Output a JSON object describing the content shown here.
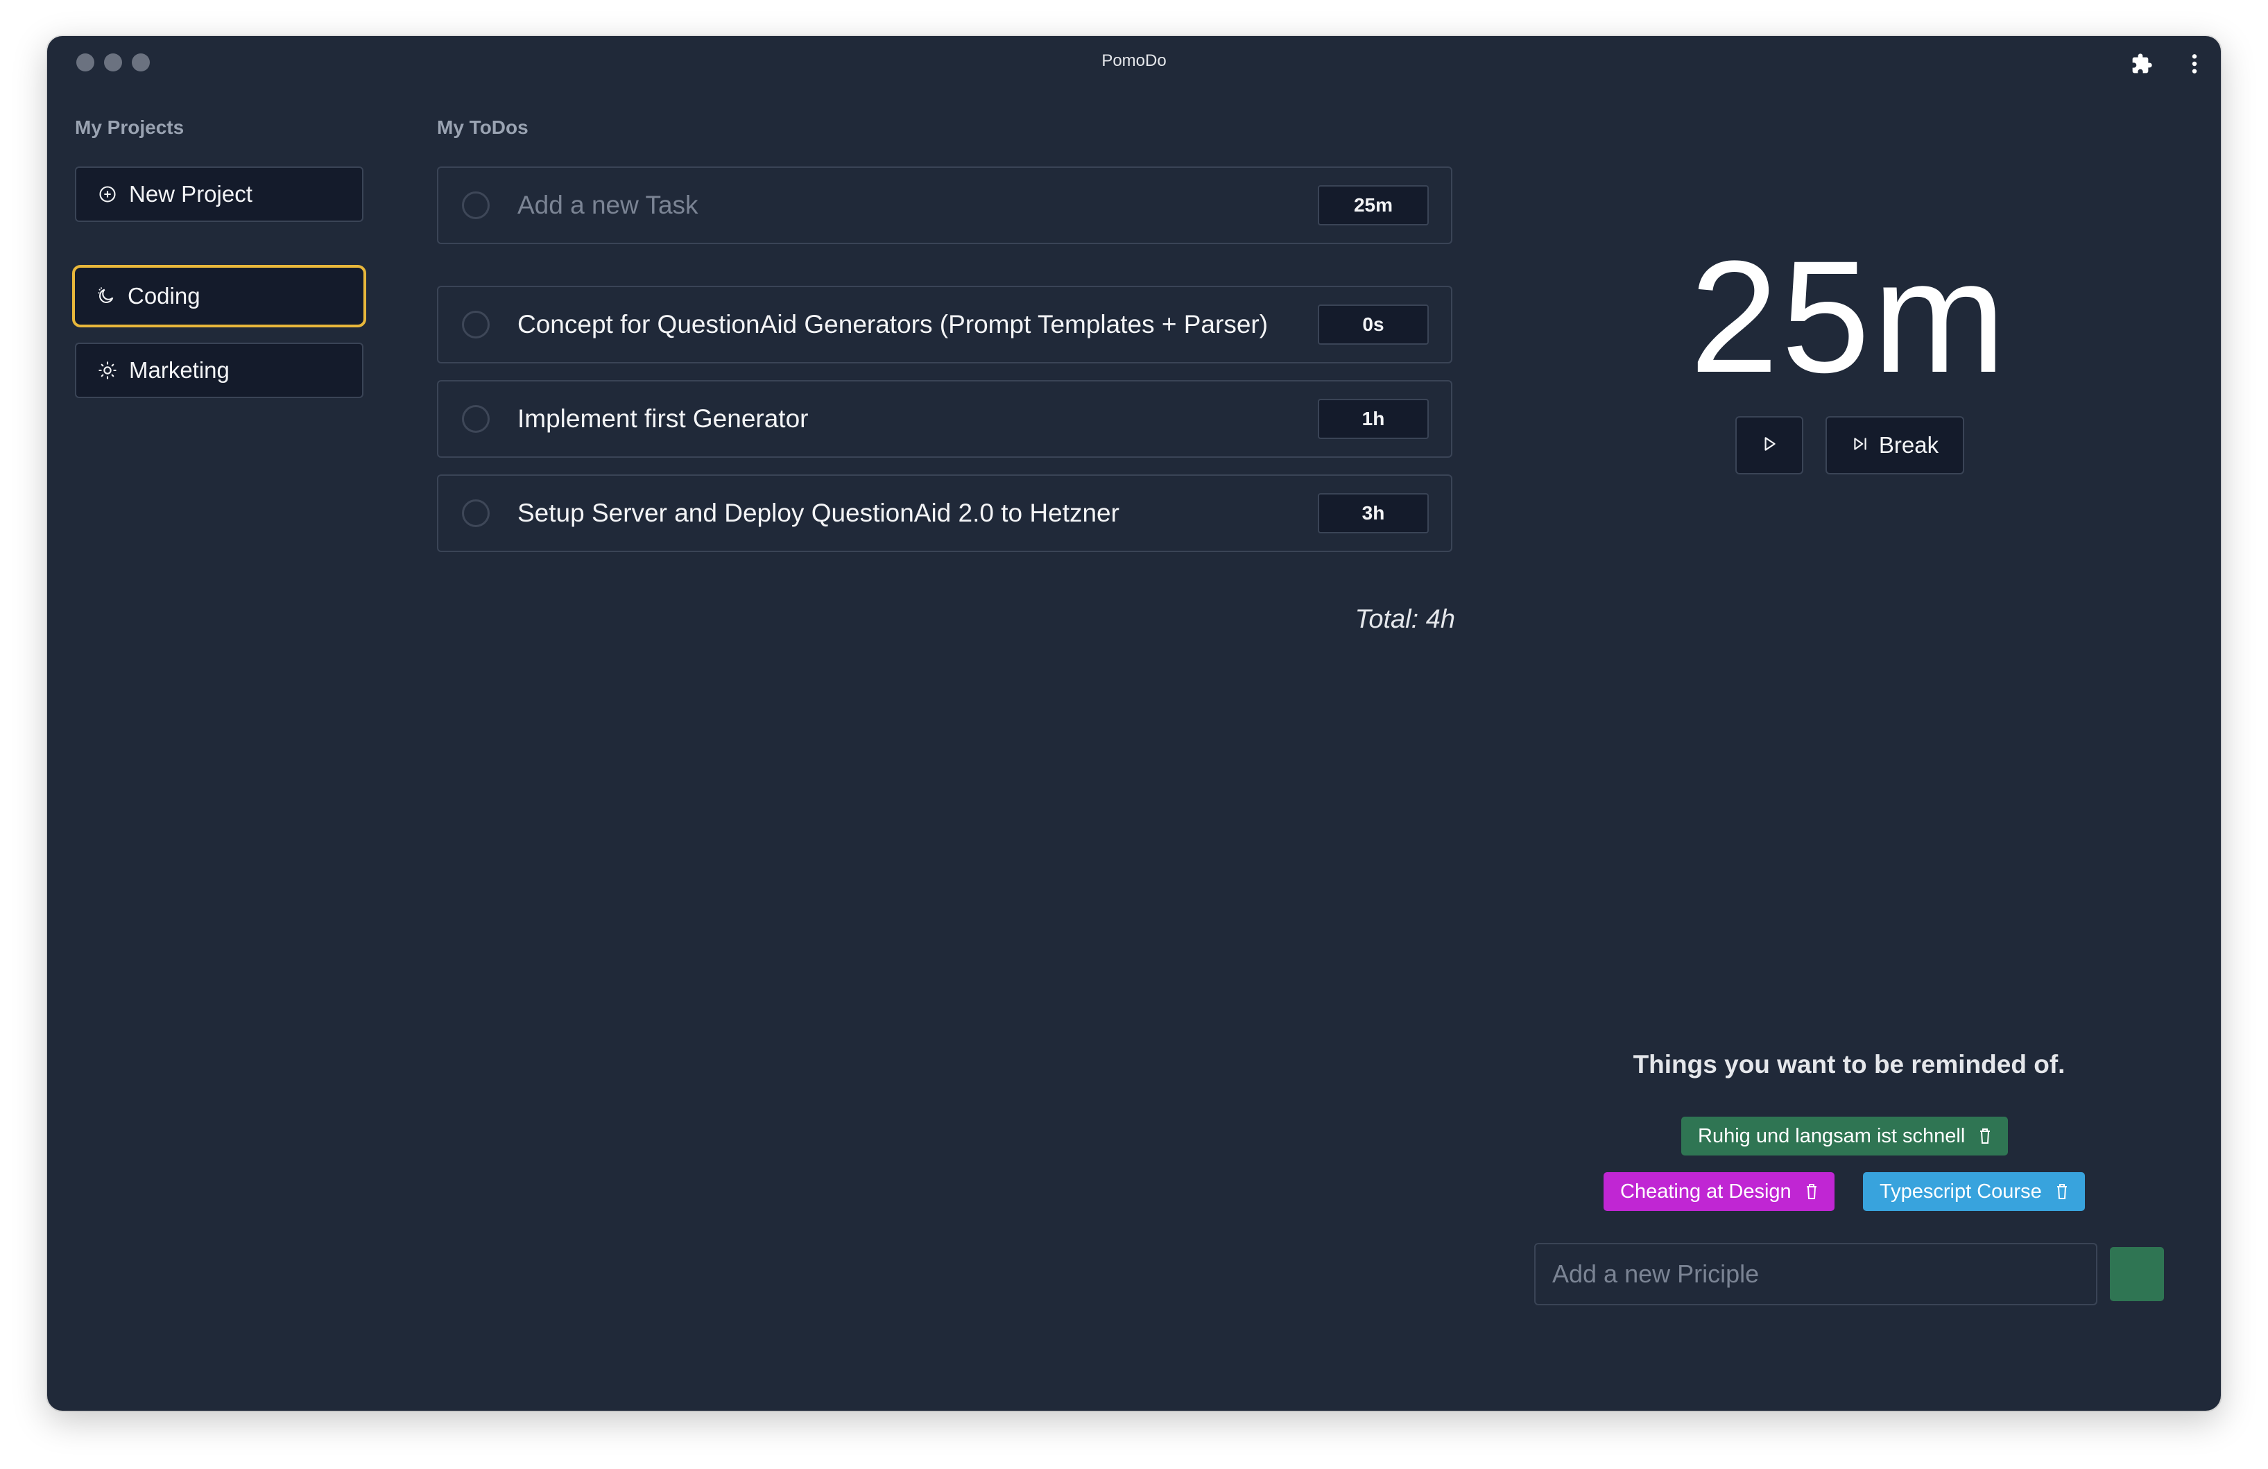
{
  "window": {
    "title": "PomoDo"
  },
  "projects": {
    "heading": "My Projects",
    "new_project_label": "New Project",
    "items": [
      {
        "label": "Coding",
        "icon": "moon-icon",
        "active": true
      },
      {
        "label": "Marketing",
        "icon": "sun-icon",
        "active": false
      }
    ]
  },
  "todos": {
    "heading": "My ToDos",
    "new_task_placeholder": "Add a new Task",
    "new_task_duration": "25m",
    "items": [
      {
        "text": "Concept for QuestionAid Generators (Prompt Templates + Parser)",
        "duration": "0s"
      },
      {
        "text": "Implement first Generator",
        "duration": "1h"
      },
      {
        "text": "Setup Server and Deploy QuestionAid 2.0 to Hetzner",
        "duration": "3h"
      }
    ],
    "total": "Total: 4h"
  },
  "timer": {
    "display": "25m",
    "break_label": "Break"
  },
  "reminders": {
    "heading": "Things you want to be reminded of.",
    "items": [
      {
        "label": "Ruhig und langsam ist schnell",
        "color": "#2f7553"
      },
      {
        "label": "Cheating at Design",
        "color": "#c026d3"
      },
      {
        "label": "Typescript Course",
        "color": "#38a3dd"
      }
    ],
    "input_placeholder": "Add a new Priciple"
  },
  "colors": {
    "background": "#202939",
    "surface": "#141b2b",
    "border": "#3a4456",
    "active_outline": "#e8b73b",
    "accent_green": "#2f7553"
  }
}
